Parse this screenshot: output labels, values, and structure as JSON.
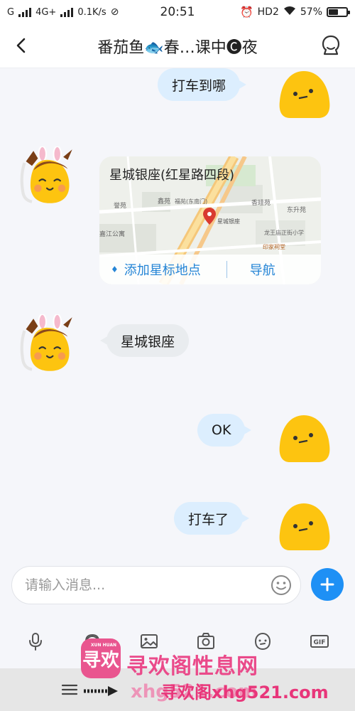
{
  "status_bar": {
    "network": "4G+",
    "speed": "0.1K/s",
    "time": "20:51",
    "hd": "HD2",
    "battery": "57%",
    "battery_level": 0.57
  },
  "header": {
    "title": "番茄鱼🐟春…课中🅒夜"
  },
  "messages": {
    "m1": "打车到哪",
    "map_location": "星城银座(红星路四段)",
    "map_labels": {
      "l1": "誉苑",
      "l2": "鑫苑",
      "l3": "星城银座",
      "l4": "东升苑",
      "l5": "嘉江公寓",
      "l6": "龙王庙正街小学",
      "l7": "印家祠堂",
      "l8": "香珪苑",
      "l9": "福苑(东南门)"
    },
    "map_add_star": "添加星标地点",
    "map_navigate": "导航",
    "m3": "星城银座",
    "m4": "OK",
    "m5": "打车了"
  },
  "input": {
    "placeholder": "请输入消息..."
  },
  "watermark": {
    "logo": "寻欢",
    "logo_sub": "XUN HUAN",
    "brand": "寻欢阁性息网",
    "url": "寻欢阁xhg521.com",
    "url_back": "xhg521.com"
  },
  "colors": {
    "accent": "#1e90f5",
    "my_bubble": "#dceefe",
    "their_bubble": "#e9ecef",
    "map_link": "#2585d6"
  }
}
